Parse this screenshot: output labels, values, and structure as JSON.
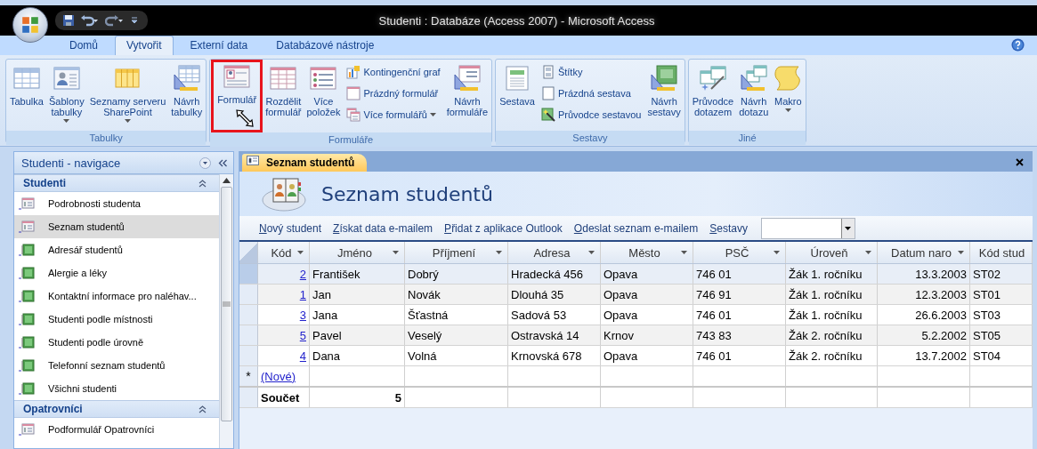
{
  "window": {
    "title": "Studenti : Databáze (Access 2007) - Microsoft Access"
  },
  "ribbon_tabs": [
    {
      "label": "Domů",
      "selected": false
    },
    {
      "label": "Vytvořit",
      "selected": true
    },
    {
      "label": "Externí data",
      "selected": false
    },
    {
      "label": "Databázové nástroje",
      "selected": false
    }
  ],
  "ribbon_groups": [
    {
      "title": "Tabulky",
      "controls": [
        {
          "kind": "large",
          "lines": [
            "Tabulka"
          ],
          "dropdown": false,
          "highlighted": false
        },
        {
          "kind": "large",
          "lines": [
            "Šablony",
            "tabulky"
          ],
          "dropdown": true,
          "highlighted": false
        },
        {
          "kind": "large",
          "lines": [
            "Seznamy serveru",
            "SharePoint"
          ],
          "dropdown": true,
          "highlighted": false
        },
        {
          "kind": "large",
          "lines": [
            "Návrh",
            "tabulky"
          ],
          "dropdown": false,
          "highlighted": false
        }
      ]
    },
    {
      "title": "Formuláře",
      "controls": [
        {
          "kind": "large",
          "lines": [
            "Formulář"
          ],
          "dropdown": false,
          "highlighted": true
        },
        {
          "kind": "large",
          "lines": [
            "Rozdělit",
            "formulář"
          ],
          "dropdown": false,
          "highlighted": false
        },
        {
          "kind": "large",
          "lines": [
            "Více",
            "položek"
          ],
          "dropdown": false,
          "highlighted": false
        },
        {
          "kind": "stack",
          "items": [
            {
              "label": "Kontingenční graf",
              "dropdown": false
            },
            {
              "label": "Prázdný formulář",
              "dropdown": false
            },
            {
              "label": "Více formulářů",
              "dropdown": true
            }
          ]
        },
        {
          "kind": "large",
          "lines": [
            "Návrh",
            "formuláře"
          ],
          "dropdown": false,
          "highlighted": false
        }
      ]
    },
    {
      "title": "Sestavy",
      "controls": [
        {
          "kind": "large",
          "lines": [
            "Sestava"
          ],
          "dropdown": false,
          "highlighted": false
        },
        {
          "kind": "stack",
          "items": [
            {
              "label": "Štítky",
              "dropdown": false
            },
            {
              "label": "Prázdná sestava",
              "dropdown": false
            },
            {
              "label": "Průvodce sestavou",
              "dropdown": false
            }
          ]
        },
        {
          "kind": "large",
          "lines": [
            "Návrh",
            "sestavy"
          ],
          "dropdown": false,
          "highlighted": false
        }
      ]
    },
    {
      "title": "Jiné",
      "controls": [
        {
          "kind": "large",
          "lines": [
            "Průvodce",
            "dotazem"
          ],
          "dropdown": false,
          "highlighted": false
        },
        {
          "kind": "large",
          "lines": [
            "Návrh",
            "dotazu"
          ],
          "dropdown": false,
          "highlighted": false
        },
        {
          "kind": "large",
          "lines": [
            "Makro"
          ],
          "dropdown": true,
          "highlighted": false
        }
      ]
    }
  ],
  "navigation": {
    "title": "Studenti - navigace",
    "groups": [
      {
        "title": "Studenti",
        "expanded": true,
        "items": [
          {
            "label": "Podrobnosti studenta",
            "kind": "form",
            "selected": false
          },
          {
            "label": "Seznam studentů",
            "kind": "form",
            "selected": true
          },
          {
            "label": "Adresář studentů",
            "kind": "report",
            "selected": false
          },
          {
            "label": "Alergie a léky",
            "kind": "report",
            "selected": false
          },
          {
            "label": "Kontaktní informace pro naléhav...",
            "kind": "report",
            "selected": false
          },
          {
            "label": "Studenti podle místnosti",
            "kind": "report",
            "selected": false
          },
          {
            "label": "Studenti podle úrovně",
            "kind": "report",
            "selected": false
          },
          {
            "label": "Telefonní seznam studentů",
            "kind": "report",
            "selected": false
          },
          {
            "label": "Všichni studenti",
            "kind": "report",
            "selected": false
          }
        ]
      },
      {
        "title": "Opatrovníci",
        "expanded": true,
        "items": [
          {
            "label": "Podformulář Opatrovníci",
            "kind": "form",
            "selected": false
          }
        ]
      }
    ]
  },
  "document": {
    "tab": "Seznam studentů",
    "heading": "Seznam studentů",
    "toolbar_links": [
      "Nový student",
      "Získat data e-mailem",
      "Přidat z aplikace Outlook",
      "Odeslat seznam e-mailem"
    ],
    "reports_label": "Sestavy",
    "table": {
      "columns": [
        {
          "label": "Kód",
          "dropdown": true
        },
        {
          "label": "Jméno",
          "dropdown": true
        },
        {
          "label": "Příjmení",
          "dropdown": true
        },
        {
          "label": "Adresa",
          "dropdown": true
        },
        {
          "label": "Město",
          "dropdown": true
        },
        {
          "label": "PSČ",
          "dropdown": true
        },
        {
          "label": "Úroveň",
          "dropdown": true
        },
        {
          "label": "Datum naro",
          "dropdown": true
        },
        {
          "label": "Kód stud",
          "dropdown": false
        }
      ],
      "rows": [
        {
          "selected": true,
          "cells": [
            "2",
            "František",
            "Dobrý",
            "Hradecká 456",
            "Opava",
            "746 01",
            "Žák 1. ročníku",
            "13.3.2003",
            "ST02"
          ]
        },
        {
          "selected": false,
          "cells": [
            "1",
            "Jan",
            "Novák",
            "Dlouhá 35",
            "Opava",
            "746 91",
            "Žák 1. ročníku",
            "12.3.2003",
            "ST01"
          ]
        },
        {
          "selected": false,
          "cells": [
            "3",
            "Jana",
            "Šťastná",
            "Sadová 53",
            "Opava",
            "746 01",
            "Žák 1. ročníku",
            "26.6.2003",
            "ST03"
          ]
        },
        {
          "selected": false,
          "cells": [
            "5",
            "Pavel",
            "Veselý",
            "Ostravská 14",
            "Krnov",
            "743 83",
            "Žák 2. ročníku",
            "5.2.2002",
            "ST05"
          ]
        },
        {
          "selected": false,
          "cells": [
            "4",
            "Dana",
            "Volná",
            "Krnovská 678",
            "Opava",
            "746 01",
            "Žák 2. ročníku",
            "13.7.2002",
            "ST04"
          ]
        }
      ],
      "new_row": {
        "marker": "*",
        "label": "(Nové)"
      },
      "totals_row": {
        "label": "Součet",
        "value": "5"
      }
    }
  }
}
